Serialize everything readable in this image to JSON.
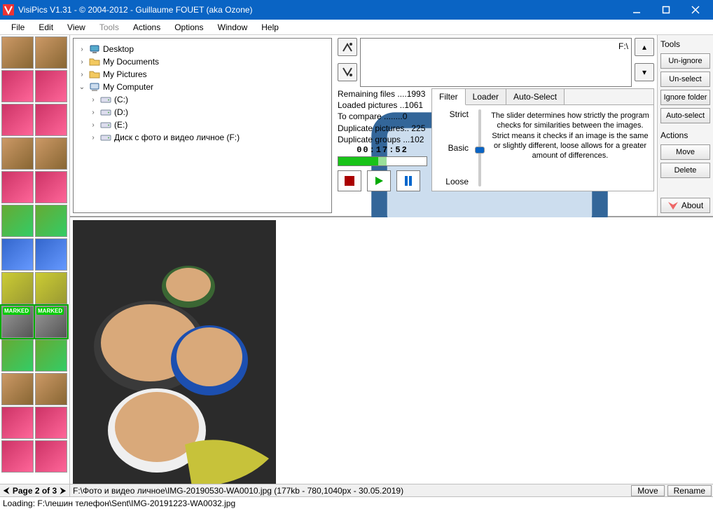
{
  "window": {
    "title": "VisiPics V1.31 - © 2004-2012 - Guillaume FOUET (aka Ozone)"
  },
  "menu": [
    "File",
    "Edit",
    "View",
    "Tools",
    "Actions",
    "Options",
    "Window",
    "Help"
  ],
  "menu_disabled": [
    "Tools"
  ],
  "tree": {
    "items": [
      {
        "exp": ">",
        "icon": "desktop",
        "label": "Desktop"
      },
      {
        "exp": ">",
        "icon": "folder",
        "label": "My Documents"
      },
      {
        "exp": ">",
        "icon": "folder",
        "label": "My Pictures"
      },
      {
        "exp": "v",
        "icon": "computer",
        "label": "My Computer",
        "children": [
          {
            "exp": ">",
            "icon": "drive",
            "label": "(C:)"
          },
          {
            "exp": ">",
            "icon": "drive",
            "label": "(D:)"
          },
          {
            "exp": ">",
            "icon": "drive",
            "label": "(E:)"
          },
          {
            "exp": ">",
            "icon": "drive",
            "label": "Диск с фото и видео личное (F:)"
          }
        ]
      }
    ]
  },
  "path": "F:\\",
  "stats": {
    "remaining": "Remaining files ....1993",
    "loaded": "Loaded pictures ..1061",
    "compare": "To compare ........0",
    "dup_pics": "Duplicate pictures.. 225",
    "dup_groups": "Duplicate groups ...102",
    "timer": "00:17:52",
    "progress_pct": 45
  },
  "tabs": {
    "items": [
      "Filter",
      "Loader",
      "Auto-Select"
    ],
    "active": "Filter"
  },
  "slider": {
    "labels": [
      "Strict",
      "Basic",
      "Loose"
    ],
    "pos_pct": 50,
    "desc": "The slider determines how strictly the program checks for similarities between the images. Strict means it checks if an image is the same or slightly different, loose allows for a greater amount of differences."
  },
  "right": {
    "tools_label": "Tools",
    "tool_buttons": [
      "Un-ignore",
      "Un-select",
      "Ignore folder",
      "Auto-select"
    ],
    "actions_label": "Actions",
    "action_buttons": [
      "Move",
      "Delete"
    ],
    "about": "About"
  },
  "pager": {
    "text": "Page 2 of 3"
  },
  "status": {
    "file": "F:\\Фото и видео личное\\IMG-20190530-WA0010.jpg (177kb - 780,1040px - 30.05.2019)",
    "btn_move": "Move",
    "btn_rename": "Rename"
  },
  "loading": "Loading: F:\\лешин телефон\\Sent\\IMG-20191223-WA0032.jpg",
  "marked_label": "MARKED"
}
